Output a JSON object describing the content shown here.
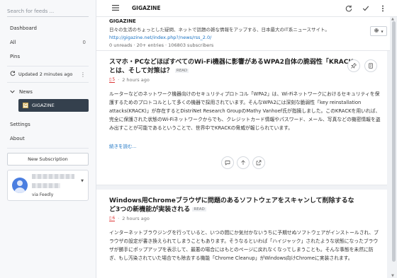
{
  "sidebar": {
    "search_placeholder": "Search for feeds ...",
    "items": [
      {
        "label": "Dashboard",
        "count": ""
      },
      {
        "label": "All",
        "count": "0"
      },
      {
        "label": "Pins",
        "count": ""
      }
    ],
    "updated": "Updated 2 minutes ago",
    "category": "News",
    "active_feed": "GIGAZINE",
    "settings": "Settings",
    "about": "About",
    "new_subscription": "New Subscription",
    "account_via": "via Feedly"
  },
  "toolbar": {
    "title": "GIGAZINE"
  },
  "feed": {
    "name": "GIGAZINE",
    "description": "日々の生活のちょっとした疑問、ネットで話題の雑な情報をアップする、日本最大のIT系ニュースサイト。",
    "url": "http://gigazine.net/index.php?/news/rss_2.0/",
    "stats": "0 unreads · 20+ entries · 106803 subscribers"
  },
  "articles": [
    {
      "title": "スマホ・PCなどほぼすべてのWi-Fi機器に影響があるWPA2自体の脆弱性「KRACK」とは、そして対策は？",
      "read_tag": "READ",
      "hatena_count": "5",
      "time": "2 hours ago",
      "body": "ルーターなどのネットワーク機器向けのセキュリティプロトコル「WPA2」は、Wi-Fiネットワークにおけるセキュリティを保護するためのプロトコルとして多くの機器で採用されています。そんなWPA2には深刻な脆弱性「key reinstallation attacks(KRACK)」が存在するとDistriNet Research GroupのMathy Vanhoef氏が指摘しました。このKRACKを用いれば、完全に保護された状態のWi-Fiネットワークからでも、クレジットカード情報やパスワード、メール、写真などの機密情報を盗み出すことが可能であるということで、世界中でKRACKの脅威が報じられています。",
      "more": "続きを読む..."
    },
    {
      "title": "Windows用Chromeブラウザに問題のあるソフトウェアをスキャンして削除するなど3つの新機能が実装される",
      "read_tag": "READ",
      "hatena_count": "6",
      "time": "2 hours ago",
      "body": "インターネットブラウジングを行っていると、いつの間にか気付かないうちに予期せぬソフトウェアがインストールされ、ブラウザの設定が書き換えられてしまうこともあります。そうなるといわば「ハイジャック」されたような状態になったブラウザが勝手にポップアップを表示して、最悪の場合にはもとのページに戻れなくなってしまうことも。そんな事態を未然に防ぎ、もし汚染されていた場合でも除去する機能「Chrome Cleanup」がWindows向けChromeに実装されます。"
    }
  ],
  "colors": {
    "sidebar_active_bg": "#34404d",
    "link": "#1a73c4",
    "hatena_red": "#d33",
    "avatar": "#4a7ee0"
  }
}
